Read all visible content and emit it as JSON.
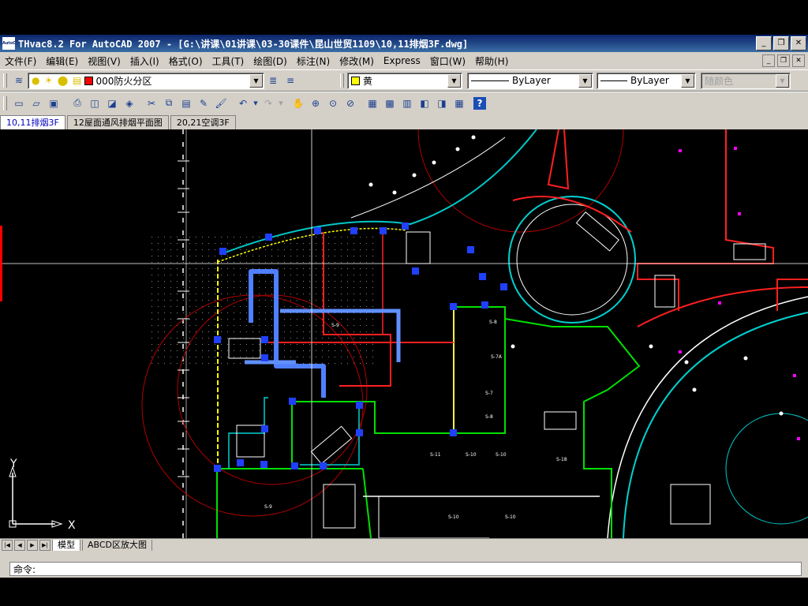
{
  "window": {
    "app_icon": "AutoCAD",
    "title": "THvac8.2 For AutoCAD 2007 - [G:\\讲课\\01讲课\\03-30课件\\昆山世贸1109\\10,11排烟3F.dwg]",
    "buttons": [
      "minimize",
      "restore",
      "close"
    ]
  },
  "menubar": {
    "items": [
      "文件(F)",
      "编辑(E)",
      "视图(V)",
      "插入(I)",
      "格式(O)",
      "工具(T)",
      "绘图(D)",
      "标注(N)",
      "修改(M)",
      "Express",
      "窗口(W)",
      "帮助(H)"
    ]
  },
  "layers_toolbar": {
    "layer_name": "000防火分区",
    "layer_color": "#ff0000",
    "color_value": "黄",
    "color_swatch": "#ffff00",
    "linetype": "ByLayer",
    "lineweight": "ByLayer",
    "plot_style": "随颜色"
  },
  "standard_toolbar": {
    "icons": [
      "new-icon",
      "open-icon",
      "save-icon",
      "plot-icon",
      "preview-icon",
      "publish-icon",
      "3d-icon",
      "cut-icon",
      "copy-icon",
      "paste-icon",
      "matchprop-icon",
      "brush-icon",
      "undo-icon",
      "redo-icon",
      "pan-icon",
      "zoom-realtime-icon",
      "zoom-window-icon",
      "zoom-previous-icon",
      "properties-icon",
      "designcenter-icon",
      "toolpalette-icon",
      "sheetset-icon",
      "markup-icon",
      "calculator-icon",
      "help-icon"
    ]
  },
  "file_tabs": [
    {
      "label": "10,11排烟3F",
      "active": true
    },
    {
      "label": "12屋面通风排烟平面图",
      "active": false
    },
    {
      "label": "20,21空调3F",
      "active": false
    }
  ],
  "drawing": {
    "ucs_x": "X",
    "ucs_y": "Y",
    "labels": [
      "S-8",
      "S-9",
      "S-7A",
      "S-7",
      "S-8",
      "S-11",
      "S-10",
      "S-10",
      "S-18",
      "S-10",
      "S-10",
      "S-9"
    ]
  },
  "layout_tabs": [
    {
      "label": "模型",
      "active": true
    },
    {
      "label": "ABCD区放大图",
      "active": false
    }
  ],
  "command": {
    "prompt": "命令:"
  }
}
